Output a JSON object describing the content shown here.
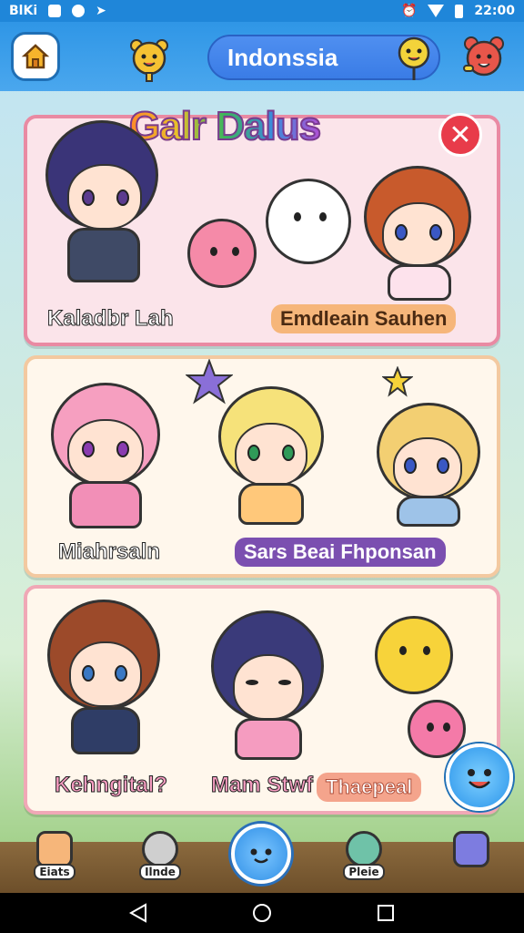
{
  "status_bar": {
    "left_text": "BlKi",
    "time": "22:00"
  },
  "header": {
    "title": "Indonssia"
  },
  "banner": {
    "title": "Galr Dalus"
  },
  "cards": [
    {
      "labels": [
        "Kaladbr Lah",
        "Emdleain Sauhen"
      ]
    },
    {
      "labels": [
        "Miahrsaln",
        "Sars Beai Fhponsan"
      ]
    },
    {
      "labels": [
        "Kehngital?",
        "Mam Stwf",
        "Thaepeal"
      ]
    }
  ],
  "bottom_nav": {
    "items": [
      {
        "label": "Eiats"
      },
      {
        "label": "Ilnde"
      },
      {
        "label": "Pleie"
      },
      {
        "label": ""
      }
    ]
  },
  "colors": {
    "accent": "#2f96e6",
    "card_border_pink": "#e98aa3",
    "chip_orange": "#f6b67a",
    "chip_purple": "#7b4fb0",
    "chip_salmon": "#f4a48c"
  },
  "icons": [
    "home-icon",
    "close-icon",
    "back-icon",
    "home-circle-icon",
    "recents-icon"
  ]
}
